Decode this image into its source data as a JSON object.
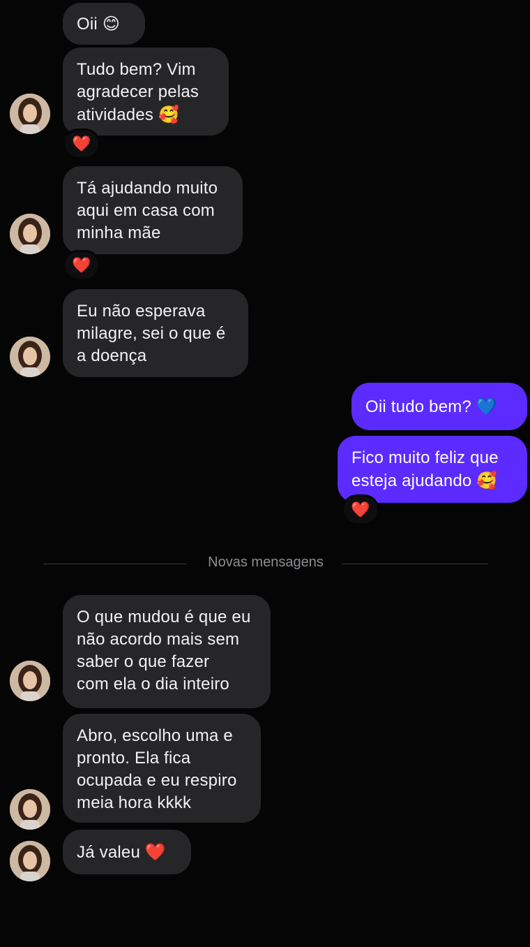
{
  "messages": {
    "m1": {
      "text": "Oii",
      "emoji": "😊"
    },
    "m2": {
      "lines": [
        "Tudo bem? Vim",
        "agradecer pelas",
        "atividades"
      ],
      "emoji": "🥰",
      "reaction": "❤️"
    },
    "m3": {
      "lines": [
        "Tá ajudando muito",
        "aqui em casa com",
        "minha mãe"
      ],
      "reaction": "❤️"
    },
    "m4": {
      "lines": [
        "Eu não esperava",
        "milagre, sei o que é",
        "a doença"
      ]
    },
    "m5": {
      "text": "Oii tudo bem?",
      "emoji": "💙"
    },
    "m6": {
      "lines": [
        "Fico muito feliz que",
        "esteja ajudando"
      ],
      "emoji": "🥰",
      "reaction": "❤️"
    },
    "m7": {
      "lines": [
        "O que mudou é que eu",
        "não acordo mais sem",
        "saber o que fazer",
        "com ela o dia inteiro"
      ]
    },
    "m8": {
      "lines": [
        "Abro, escolho uma e",
        "pronto. Ela fica",
        "ocupada e eu respiro",
        "meia hora kkkk"
      ]
    },
    "m9": {
      "text": "Já valeu",
      "emoji": "❤️"
    }
  },
  "divider": {
    "label": "Novas mensagens"
  },
  "colors": {
    "background": "#050505",
    "incoming_bubble": "#262628",
    "outgoing_bubble": "#5b2bff",
    "divider_text": "#8e8e93"
  },
  "icons": {
    "avatar": "contact-avatar",
    "reaction": "red-heart-icon"
  }
}
